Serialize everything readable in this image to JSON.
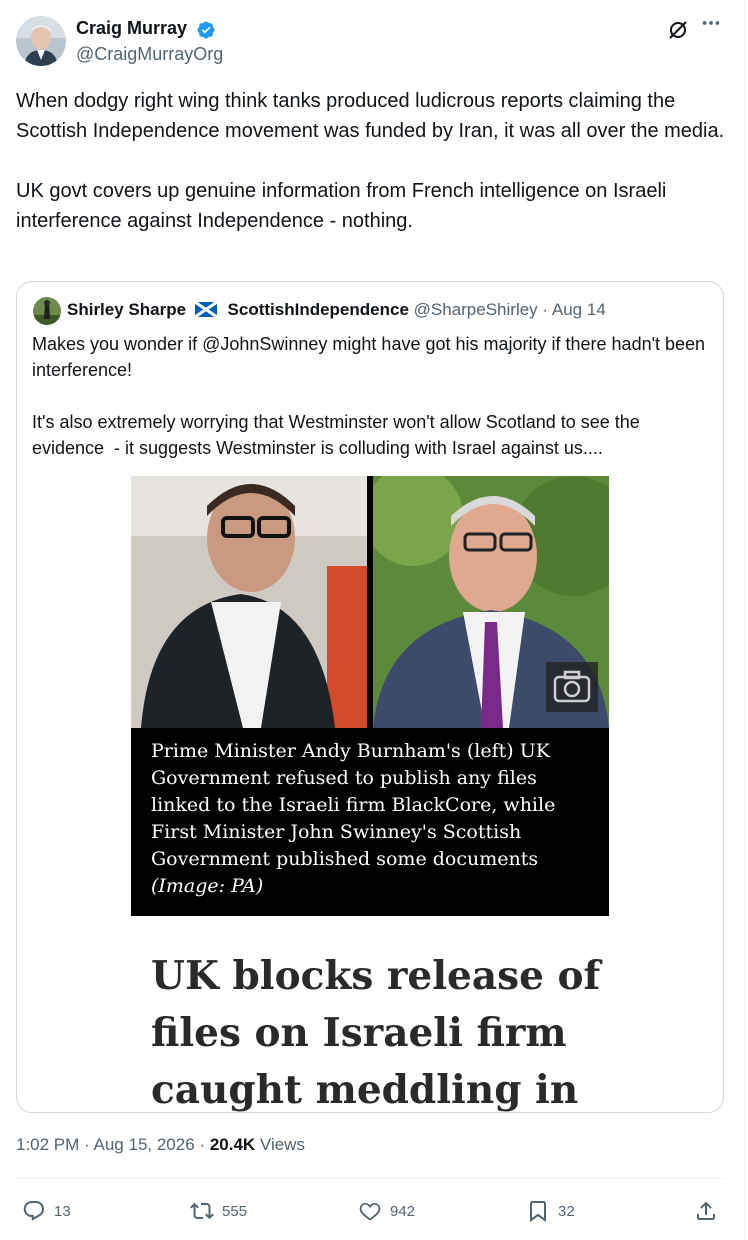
{
  "author": {
    "name": "Craig Murray",
    "handle": "@CraigMurrayOrg"
  },
  "tweet": {
    "text": "When dodgy right wing think tanks produced ludicrous reports claiming the Scottish Independence movement was funded by Iran, it was all over the media.\n\nUK govt covers up genuine information from French intelligence on Israeli interference against Independence - nothing."
  },
  "quote": {
    "name": "Shirley Sharpe",
    "name_suffix": "ScottishIndependence",
    "handle": "@SharpeShirley",
    "separator": "·",
    "date": "Aug 14",
    "text": "Makes you wonder if @JohnSwinney might have got his majority if there hadn't been interference!\n\nIt's also extremely worrying that Westminster won't allow Scotland to see the evidence  - it suggests Westminster is colluding with Israel against us....",
    "caption": "Prime Minister Andy Burnham's (left) UK Government refused to publish any files linked to the Israeli firm BlackCore, while First Minister John Swinney's Scottish Government published some documents",
    "caption_credit": "(Image: PA)",
    "headline": "UK blocks release of files on Israeli firm caught meddling in"
  },
  "meta": {
    "time": "1:02 PM",
    "separator": "·",
    "date": "Aug 15, 2026",
    "views_count": "20.4K",
    "views_label": "Views"
  },
  "actions": {
    "replies": "13",
    "reposts": "555",
    "likes": "942",
    "bookmarks": "32"
  },
  "icons": [
    "verified-icon",
    "grok-icon",
    "more-icon",
    "scotland-flag-icon",
    "camera-icon",
    "reply-icon",
    "repost-icon",
    "like-icon",
    "bookmark-icon",
    "share-icon"
  ],
  "colors": {
    "verified": "#1d9bf0",
    "muted": "#536471",
    "text": "#0f1419",
    "border": "#cfd9de"
  }
}
